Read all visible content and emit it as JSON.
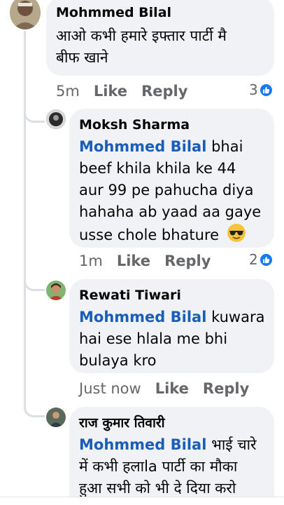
{
  "comments": [
    {
      "author": "Mohmmed Bilal",
      "text_lines": [
        "आओ कभी हमारे इफ्तार पार्टी मै",
        "बीफ खाने"
      ],
      "time": "5m",
      "like_label": "Like",
      "reply_label": "Reply",
      "reaction_count": "3"
    },
    {
      "author": "Moksh Sharma",
      "mention": "Mohmmed Bilal",
      "first_line_rest": " bhai",
      "text_lines": [
        "beef khila khila ke 44",
        "aur 99 pe pahucha diya",
        "hahaha ab yaad aa gaye",
        "usse chole bhature"
      ],
      "time": "1m",
      "like_label": "Like",
      "reply_label": "Reply",
      "reaction_count": "2",
      "emoji": "smiling-face-with-sunglasses"
    },
    {
      "author": "Rewati Tiwari",
      "mention": "Mohmmed Bilal",
      "first_line_rest": " kuwara",
      "text_lines": [
        "hai ese hlala me bhi",
        "bulaya kro"
      ],
      "time": "Just now",
      "like_label": "Like",
      "reply_label": "Reply"
    },
    {
      "author": "राज कुमार तिवारी",
      "mention": "Mohmmed Bilal",
      "first_line_rest": " भाई चारे",
      "text_lines": [
        "में कभी हलाla पार्टी का मौका",
        "हुआ सभी को भी दे दिया करो"
      ]
    }
  ],
  "colors": {
    "bubble": "#f0f2f5",
    "mention": "#1b5eb8",
    "meta": "#65676b",
    "like_badge": "#1877f2"
  }
}
